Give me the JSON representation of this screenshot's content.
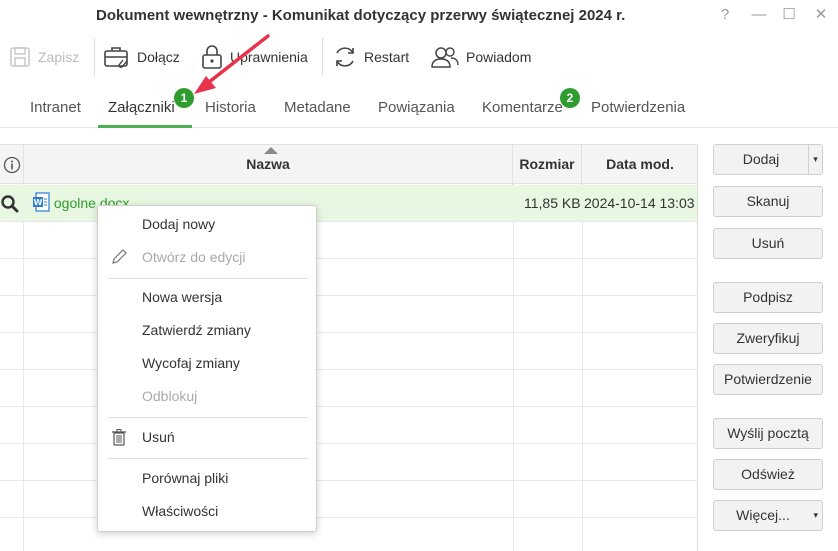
{
  "window": {
    "title": "Dokument wewnętrzny - Komunikat dotyczący przerwy świątecznej 2024 r.",
    "help": "?",
    "minimize": "—",
    "maximize": "☐",
    "close": "✕"
  },
  "toolbar": {
    "save": "Zapisz",
    "attach": "Dołącz",
    "permissions": "Uprawnienia",
    "restart": "Restart",
    "notify": "Powiadom"
  },
  "tabs": [
    {
      "label": "Intranet"
    },
    {
      "label": "Załączniki",
      "badge": "1"
    },
    {
      "label": "Historia"
    },
    {
      "label": "Metadane"
    },
    {
      "label": "Powiązania"
    },
    {
      "label": "Komentarze",
      "badge": "2"
    },
    {
      "label": "Potwierdzenia"
    }
  ],
  "grid": {
    "columns": {
      "info": "i",
      "name": "Nazwa",
      "size": "Rozmiar",
      "modified": "Data mod."
    },
    "rows": [
      {
        "name": "ogolne.docx",
        "size": "11,85 KB",
        "modified": "2024-10-14 13:03"
      }
    ]
  },
  "side_buttons": {
    "add": "Dodaj",
    "add_arrow": "▾",
    "scan": "Skanuj",
    "delete": "Usuń",
    "sign": "Podpisz",
    "verify": "Zweryfikuj",
    "confirmation": "Potwierdzenie",
    "send_mail": "Wyślij pocztą",
    "refresh": "Odśwież",
    "more": "Więcej...",
    "more_arrow": "▾"
  },
  "context_menu": {
    "add_new": "Dodaj nowy",
    "open_edit": "Otwórz do edycji",
    "new_version": "Nowa wersja",
    "approve_changes": "Zatwierdź zmiany",
    "revert_changes": "Wycofaj zmiany",
    "unlock": "Odblokuj",
    "delete": "Usuń",
    "compare": "Porównaj pliki",
    "properties": "Właściwości"
  },
  "colors": {
    "accent_green": "#2e9c2e",
    "selected_row": "#e8f7e2",
    "annotation_red": "#e8334a"
  }
}
